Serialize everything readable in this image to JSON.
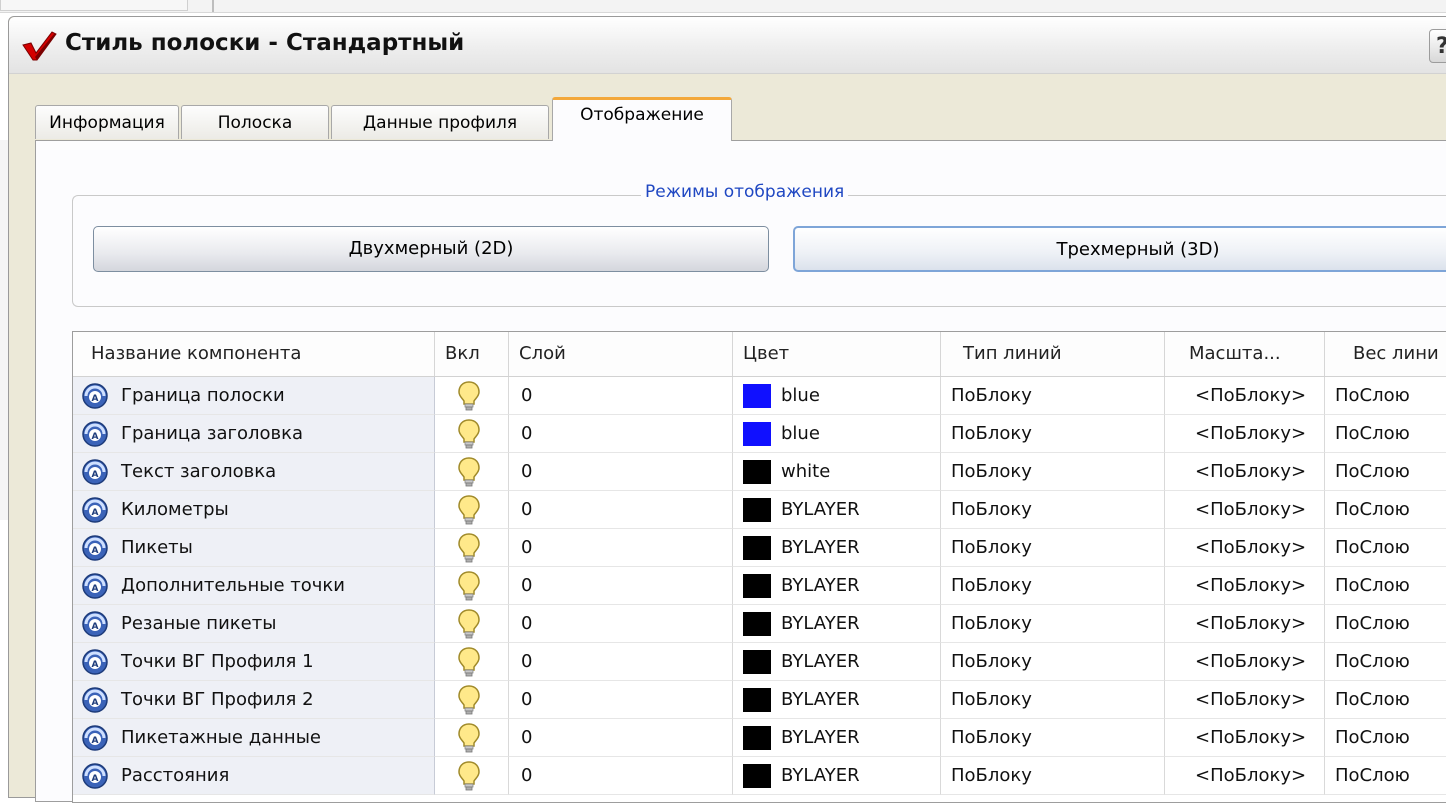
{
  "dialog": {
    "title": "Стиль полоски - Стандартный",
    "help_label": "?"
  },
  "tabs": [
    {
      "label": "Информация",
      "active": false
    },
    {
      "label": "Полоска",
      "active": false
    },
    {
      "label": "Данные профиля",
      "active": false
    },
    {
      "label": "Отображение",
      "active": true
    }
  ],
  "display_modes": {
    "legend": "Режимы отображения",
    "btn_2d": "Двухмерный (2D)",
    "btn_3d": "Трехмерный (3D)",
    "selected": "3D"
  },
  "grid": {
    "headers": [
      "Название компонента",
      "Вкл",
      "Слой",
      "Цвет",
      "Тип линий",
      "Масшта...",
      "Вес лини"
    ],
    "rows": [
      {
        "name": "Граница полоски",
        "on": true,
        "layer": "0",
        "color": "blue",
        "color_hex": "#1010ff",
        "linetype": "ПоБлоку",
        "scale": "<ПоБлоку>",
        "weight": "ПоСлою"
      },
      {
        "name": "Граница заголовка",
        "on": true,
        "layer": "0",
        "color": "blue",
        "color_hex": "#1010ff",
        "linetype": "ПоБлоку",
        "scale": "<ПоБлоку>",
        "weight": "ПоСлою"
      },
      {
        "name": "Текст заголовка",
        "on": true,
        "layer": "0",
        "color": "white",
        "color_hex": "#000000",
        "linetype": "ПоБлоку",
        "scale": "<ПоБлоку>",
        "weight": "ПоСлою"
      },
      {
        "name": "Километры",
        "on": true,
        "layer": "0",
        "color": "BYLAYER",
        "color_hex": "#000000",
        "linetype": "ПоБлоку",
        "scale": "<ПоБлоку>",
        "weight": "ПоСлою"
      },
      {
        "name": "Пикеты",
        "on": true,
        "layer": "0",
        "color": "BYLAYER",
        "color_hex": "#000000",
        "linetype": "ПоБлоку",
        "scale": "<ПоБлоку>",
        "weight": "ПоСлою"
      },
      {
        "name": "Дополнительные точки",
        "on": true,
        "layer": "0",
        "color": "BYLAYER",
        "color_hex": "#000000",
        "linetype": "ПоБлоку",
        "scale": "<ПоБлоку>",
        "weight": "ПоСлою"
      },
      {
        "name": "Резаные пикеты",
        "on": true,
        "layer": "0",
        "color": "BYLAYER",
        "color_hex": "#000000",
        "linetype": "ПоБлоку",
        "scale": "<ПоБлоку>",
        "weight": "ПоСлою"
      },
      {
        "name": "Точки ВГ Профиля 1",
        "on": true,
        "layer": "0",
        "color": "BYLAYER",
        "color_hex": "#000000",
        "linetype": "ПоБлоку",
        "scale": "<ПоБлоку>",
        "weight": "ПоСлою"
      },
      {
        "name": "Точки ВГ Профиля 2",
        "on": true,
        "layer": "0",
        "color": "BYLAYER",
        "color_hex": "#000000",
        "linetype": "ПоБлоку",
        "scale": "<ПоБлоку>",
        "weight": "ПоСлою"
      },
      {
        "name": "Пикетажные данные",
        "on": true,
        "layer": "0",
        "color": "BYLAYER",
        "color_hex": "#000000",
        "linetype": "ПоБлоку",
        "scale": "<ПоБлоку>",
        "weight": "ПоСлою"
      },
      {
        "name": "Расстояния",
        "on": true,
        "layer": "0",
        "color": "BYLAYER",
        "color_hex": "#000000",
        "linetype": "ПоБлоку",
        "scale": "<ПоБлоку>",
        "weight": "ПоСлою"
      }
    ]
  },
  "icons": {
    "title": "red-checkmark-icon",
    "component": "component-style-icon",
    "visibility": "lightbulb-icon"
  },
  "colors": {
    "tab_highlight": "#f3a83b",
    "legend_text": "#1f47c2",
    "bulb": "#ffe98a"
  }
}
